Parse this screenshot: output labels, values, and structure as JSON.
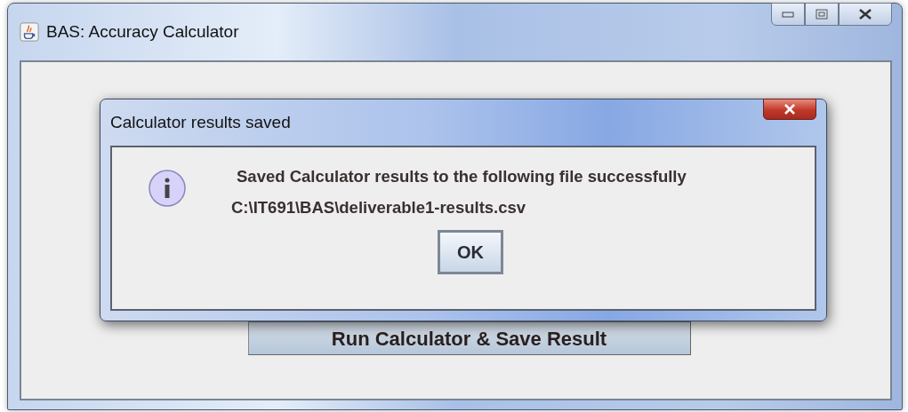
{
  "window": {
    "title": "BAS: Accuracy Calculator",
    "button": "Run Calculator & Save Result"
  },
  "dialog": {
    "title": "Calculator results saved",
    "kind": "info",
    "message": "Saved Calculator results to the following file successfully",
    "path": "C:\\IT691\\BAS\\deliverable1-results.csv",
    "button": "OK"
  }
}
